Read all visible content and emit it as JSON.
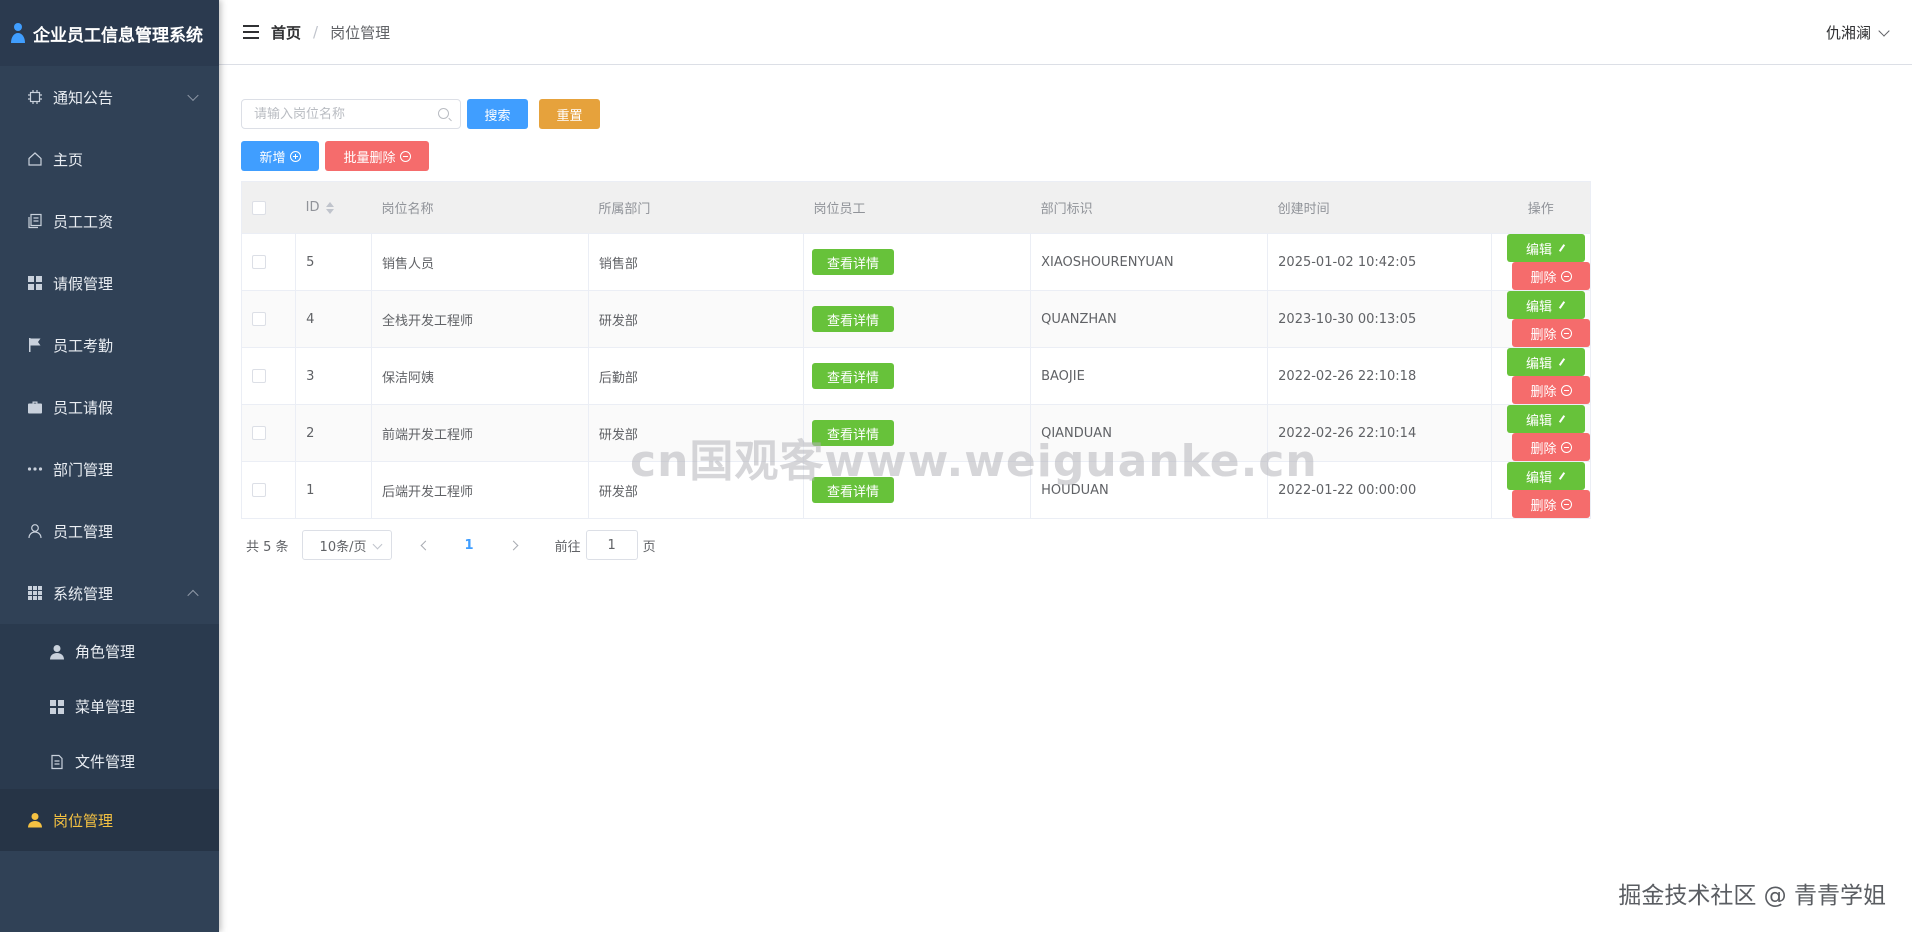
{
  "app": {
    "title": "企业员工信息管理系统"
  },
  "sidebar": {
    "items": [
      {
        "label": "通知公告",
        "icon": "cpu-icon",
        "arrow": "down"
      },
      {
        "label": "主页",
        "icon": "home-icon"
      },
      {
        "label": "员工工资",
        "icon": "document-copy-icon"
      },
      {
        "label": "请假管理",
        "icon": "grid-icon"
      },
      {
        "label": "员工考勤",
        "icon": "flag-icon"
      },
      {
        "label": "员工请假",
        "icon": "briefcase-icon"
      },
      {
        "label": "部门管理",
        "icon": "more-icon"
      },
      {
        "label": "员工管理",
        "icon": "user-icon"
      },
      {
        "label": "系统管理",
        "icon": "menu-icon",
        "arrow": "up"
      }
    ],
    "sub_items": [
      {
        "label": "角色管理",
        "icon": "user-solid-icon"
      },
      {
        "label": "菜单管理",
        "icon": "grid-icon"
      },
      {
        "label": "文件管理",
        "icon": "document-icon"
      }
    ],
    "active_item": {
      "label": "岗位管理",
      "icon": "user-solid-icon"
    }
  },
  "navbar": {
    "breadcrumb_home": "首页",
    "breadcrumb_sep": "/",
    "breadcrumb_current": "岗位管理",
    "user_name": "仇湘澜"
  },
  "search": {
    "placeholder": "请输入岗位名称",
    "value": ""
  },
  "toolbar": {
    "search_label": "搜索",
    "reset_label": "重置",
    "add_label": "新增",
    "batch_delete_label": "批量删除"
  },
  "table": {
    "columns": [
      "ID",
      "岗位名称",
      "所属部门",
      "岗位员工",
      "部门标识",
      "创建时间",
      "操作"
    ],
    "rows": [
      {
        "id": "5",
        "name": "销售人员",
        "dept": "销售部",
        "staff_btn": "查看详情",
        "tag": "XIAOSHOURENYUAN",
        "created": "2025-01-02 10:42:05"
      },
      {
        "id": "4",
        "name": "全栈开发工程师",
        "dept": "研发部",
        "staff_btn": "查看详情",
        "tag": "QUANZHAN",
        "created": "2023-10-30 00:13:05"
      },
      {
        "id": "3",
        "name": "保洁阿姨",
        "dept": "后勤部",
        "staff_btn": "查看详情",
        "tag": "BAOJIE",
        "created": "2022-02-26 22:10:18"
      },
      {
        "id": "2",
        "name": "前端开发工程师",
        "dept": "研发部",
        "staff_btn": "查看详情",
        "tag": "QIANDUAN",
        "created": "2022-02-26 22:10:14"
      },
      {
        "id": "1",
        "name": "后端开发工程师",
        "dept": "研发部",
        "staff_btn": "查看详情",
        "tag": "HOUDUAN",
        "created": "2022-01-22 00:00:00"
      }
    ],
    "edit_label": "编辑",
    "delete_label": "删除"
  },
  "pagination": {
    "total": "共 5 条",
    "page_size": "10条/页",
    "current_page": "1",
    "goto_prefix": "前往",
    "goto_value": "1",
    "goto_suffix": "页"
  },
  "overlay": {
    "watermark": "cn国观客www.weiguanke.cn",
    "corner_credit": "掘金技术社区 @ 青青学姐"
  },
  "colors": {
    "sidebar_bg": "#304156",
    "active_text": "#f5c242",
    "primary": "#409eff",
    "warning": "#e6a23c",
    "danger": "#f56c6c",
    "success": "#67c23a"
  }
}
